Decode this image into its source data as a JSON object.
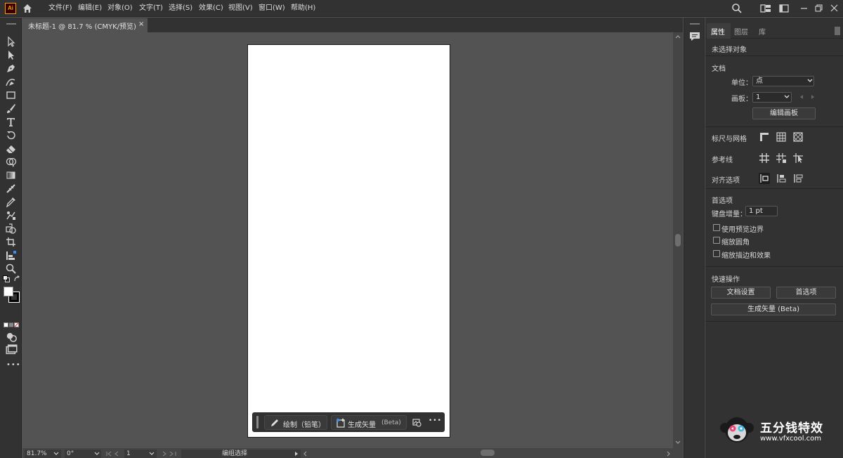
{
  "app": {
    "logo_text": "Ai",
    "menus": [
      "文件(F)",
      "编辑(E)",
      "对象(O)",
      "文字(T)",
      "选择(S)",
      "效果(C)",
      "视图(V)",
      "窗口(W)",
      "帮助(H)"
    ]
  },
  "document": {
    "tab_title": "未标题-1 @ 81.7 % (CMYK/预览)",
    "tab_close": "×"
  },
  "taskbar": {
    "draw_label": "绘制（铅笔）",
    "vector_label": "生成矢量",
    "vector_beta": "(Beta)",
    "more": "•••"
  },
  "status": {
    "zoom": "81.7%",
    "rotation": "0°",
    "artboard": "1",
    "tool": "编组选择"
  },
  "panel": {
    "tabs": [
      "属性",
      "图层",
      "库"
    ],
    "no_selection": "未选择对象",
    "document_section": "文档",
    "units_label": "单位：",
    "units_value": "点",
    "artboard_label": "画板：",
    "artboard_value": "1",
    "edit_artboard_button": "编辑画板",
    "rulers_grids": "标尺与网格",
    "guides": "参考线",
    "align_options": "对齐选项",
    "preferences_section": "首选项",
    "keyboard_increment_label": "键盘增量：",
    "keyboard_increment_value": "1 pt",
    "use_preview_bounds": "使用预览边界",
    "scale_corners": "缩放圆角",
    "scale_strokes": "缩放描边和效果",
    "quick_actions": "快速操作",
    "doc_setup_button": "文档设置",
    "preferences_button": "首选项",
    "generate_vector_button": "生成矢量 (Beta)"
  },
  "watermark": {
    "title": "五分钱特效",
    "url": "www.vfxcool.com"
  },
  "colors": {
    "accent_logo": "#ff9a00",
    "chrome_dark": "#323232",
    "canvas": "#535353",
    "artboard": "#ffffff"
  }
}
